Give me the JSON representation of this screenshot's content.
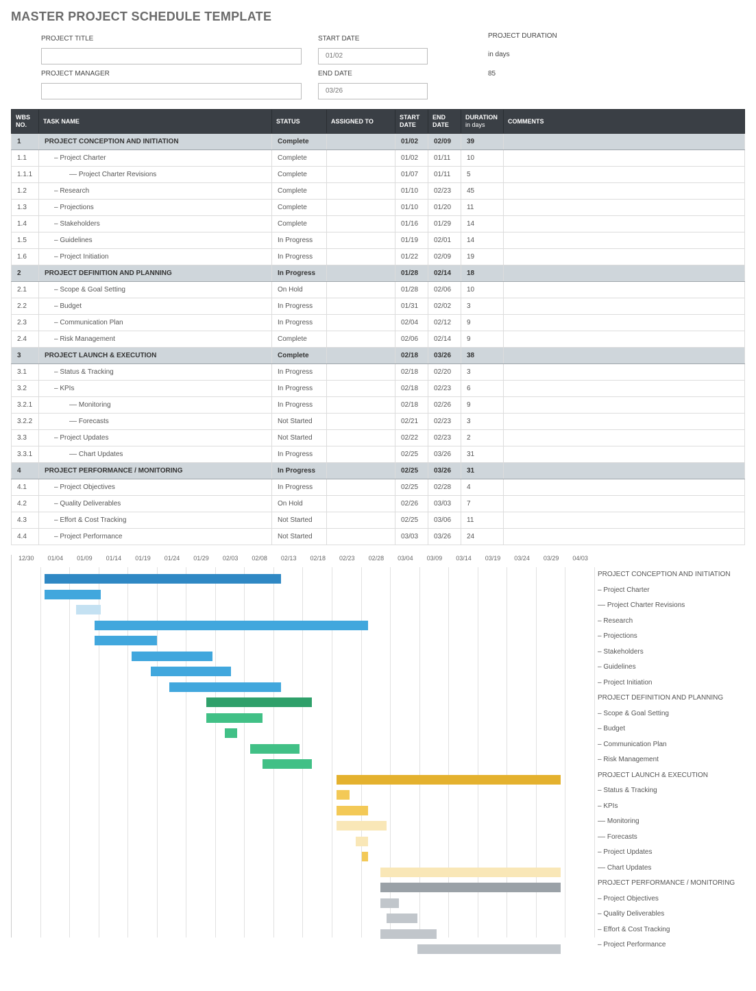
{
  "title": "MASTER PROJECT SCHEDULE TEMPLATE",
  "form": {
    "project_title_lbl": "PROJECT TITLE",
    "project_title_val": "",
    "project_manager_lbl": "PROJECT MANAGER",
    "project_manager_val": "",
    "start_date_lbl": "START DATE",
    "start_date_val": "01/02",
    "end_date_lbl": "END DATE",
    "end_date_val": "03/26",
    "duration_lbl": "PROJECT DURATION",
    "duration_unit": "in days",
    "duration_val": "85"
  },
  "headers": {
    "wbs": "WBS NO.",
    "task": "TASK NAME",
    "status": "STATUS",
    "assigned": "ASSIGNED TO",
    "start": "START DATE",
    "end": "END DATE",
    "dur": "DURATION",
    "dur_sub": "in days",
    "comments": "COMMENTS"
  },
  "rows": [
    {
      "wbs": "1",
      "name": "PROJECT CONCEPTION AND INITIATION",
      "status": "Complete",
      "assigned": "",
      "start": "01/02",
      "end": "02/09",
      "dur": "39",
      "comments": "",
      "section": true,
      "indent": 0
    },
    {
      "wbs": "1.1",
      "name": "– Project Charter",
      "status": "Complete",
      "assigned": "",
      "start": "01/02",
      "end": "01/11",
      "dur": "10",
      "comments": "",
      "section": false,
      "indent": 1
    },
    {
      "wbs": "1.1.1",
      "name": "–– Project Charter Revisions",
      "status": "Complete",
      "assigned": "",
      "start": "01/07",
      "end": "01/11",
      "dur": "5",
      "comments": "",
      "section": false,
      "indent": 2
    },
    {
      "wbs": "1.2",
      "name": "– Research",
      "status": "Complete",
      "assigned": "",
      "start": "01/10",
      "end": "02/23",
      "dur": "45",
      "comments": "",
      "section": false,
      "indent": 1
    },
    {
      "wbs": "1.3",
      "name": "– Projections",
      "status": "Complete",
      "assigned": "",
      "start": "01/10",
      "end": "01/20",
      "dur": "11",
      "comments": "",
      "section": false,
      "indent": 1
    },
    {
      "wbs": "1.4",
      "name": "– Stakeholders",
      "status": "Complete",
      "assigned": "",
      "start": "01/16",
      "end": "01/29",
      "dur": "14",
      "comments": "",
      "section": false,
      "indent": 1
    },
    {
      "wbs": "1.5",
      "name": "– Guidelines",
      "status": "In Progress",
      "assigned": "",
      "start": "01/19",
      "end": "02/01",
      "dur": "14",
      "comments": "",
      "section": false,
      "indent": 1
    },
    {
      "wbs": "1.6",
      "name": "– Project Initiation",
      "status": "In Progress",
      "assigned": "",
      "start": "01/22",
      "end": "02/09",
      "dur": "19",
      "comments": "",
      "section": false,
      "indent": 1
    },
    {
      "wbs": "2",
      "name": "PROJECT DEFINITION AND PLANNING",
      "status": "In Progress",
      "assigned": "",
      "start": "01/28",
      "end": "02/14",
      "dur": "18",
      "comments": "",
      "section": true,
      "indent": 0
    },
    {
      "wbs": "2.1",
      "name": "– Scope & Goal Setting",
      "status": "On Hold",
      "assigned": "",
      "start": "01/28",
      "end": "02/06",
      "dur": "10",
      "comments": "",
      "section": false,
      "indent": 1
    },
    {
      "wbs": "2.2",
      "name": "– Budget",
      "status": "In Progress",
      "assigned": "",
      "start": "01/31",
      "end": "02/02",
      "dur": "3",
      "comments": "",
      "section": false,
      "indent": 1
    },
    {
      "wbs": "2.3",
      "name": "– Communication Plan",
      "status": "In Progress",
      "assigned": "",
      "start": "02/04",
      "end": "02/12",
      "dur": "9",
      "comments": "",
      "section": false,
      "indent": 1
    },
    {
      "wbs": "2.4",
      "name": "– Risk Management",
      "status": "Complete",
      "assigned": "",
      "start": "02/06",
      "end": "02/14",
      "dur": "9",
      "comments": "",
      "section": false,
      "indent": 1
    },
    {
      "wbs": "3",
      "name": "PROJECT LAUNCH & EXECUTION",
      "status": "Complete",
      "assigned": "",
      "start": "02/18",
      "end": "03/26",
      "dur": "38",
      "comments": "",
      "section": true,
      "indent": 0
    },
    {
      "wbs": "3.1",
      "name": "– Status & Tracking",
      "status": "In Progress",
      "assigned": "",
      "start": "02/18",
      "end": "02/20",
      "dur": "3",
      "comments": "",
      "section": false,
      "indent": 1
    },
    {
      "wbs": "3.2",
      "name": "– KPIs",
      "status": "In Progress",
      "assigned": "",
      "start": "02/18",
      "end": "02/23",
      "dur": "6",
      "comments": "",
      "section": false,
      "indent": 1
    },
    {
      "wbs": "3.2.1",
      "name": "–– Monitoring",
      "status": "In Progress",
      "assigned": "",
      "start": "02/18",
      "end": "02/26",
      "dur": "9",
      "comments": "",
      "section": false,
      "indent": 2
    },
    {
      "wbs": "3.2.2",
      "name": "–– Forecasts",
      "status": "Not Started",
      "assigned": "",
      "start": "02/21",
      "end": "02/23",
      "dur": "3",
      "comments": "",
      "section": false,
      "indent": 2
    },
    {
      "wbs": "3.3",
      "name": "– Project Updates",
      "status": "Not Started",
      "assigned": "",
      "start": "02/22",
      "end": "02/23",
      "dur": "2",
      "comments": "",
      "section": false,
      "indent": 1
    },
    {
      "wbs": "3.3.1",
      "name": "–– Chart Updates",
      "status": "In Progress",
      "assigned": "",
      "start": "02/25",
      "end": "03/26",
      "dur": "31",
      "comments": "",
      "section": false,
      "indent": 2
    },
    {
      "wbs": "4",
      "name": "PROJECT PERFORMANCE / MONITORING",
      "status": "In Progress",
      "assigned": "",
      "start": "02/25",
      "end": "03/26",
      "dur": "31",
      "comments": "",
      "section": true,
      "indent": 0
    },
    {
      "wbs": "4.1",
      "name": "– Project Objectives",
      "status": "In Progress",
      "assigned": "",
      "start": "02/25",
      "end": "02/28",
      "dur": "4",
      "comments": "",
      "section": false,
      "indent": 1
    },
    {
      "wbs": "4.2",
      "name": "– Quality Deliverables",
      "status": "On Hold",
      "assigned": "",
      "start": "02/26",
      "end": "03/03",
      "dur": "7",
      "comments": "",
      "section": false,
      "indent": 1
    },
    {
      "wbs": "4.3",
      "name": "– Effort & Cost Tracking",
      "status": "Not Started",
      "assigned": "",
      "start": "02/25",
      "end": "03/06",
      "dur": "11",
      "comments": "",
      "section": false,
      "indent": 1
    },
    {
      "wbs": "4.4",
      "name": "– Project Performance",
      "status": "Not Started",
      "assigned": "",
      "start": "03/03",
      "end": "03/26",
      "dur": "24",
      "comments": "",
      "section": false,
      "indent": 1
    }
  ],
  "chart_data": {
    "type": "bar",
    "title": "",
    "xlabel": "",
    "ylabel": "",
    "axis_ticks": [
      "12/30",
      "01/04",
      "01/09",
      "01/14",
      "01/19",
      "01/24",
      "01/29",
      "02/03",
      "02/08",
      "02/13",
      "02/18",
      "02/23",
      "02/28",
      "03/04",
      "03/09",
      "03/14",
      "03/19",
      "03/24",
      "03/29",
      "04/03"
    ],
    "origin": "12/30",
    "series_colors": {
      "group1_dark": "#2f88c4",
      "group1_light": "#41a7dd",
      "group1_pale": "#c4e1f2",
      "group2_dark": "#2fa06a",
      "group2_light": "#41c086",
      "group3_dark": "#e4b12e",
      "group3_light": "#f3c957",
      "group3_pale": "#f9e7b7",
      "group4_dark": "#9aa1a7",
      "group4_light": "#c1c6cb"
    },
    "bars": [
      {
        "label": "PROJECT CONCEPTION AND INITIATION",
        "start": "01/02",
        "end": "02/09",
        "days": 39,
        "color": "group1_dark"
      },
      {
        "label": "– Project Charter",
        "start": "01/02",
        "end": "01/11",
        "days": 10,
        "color": "group1_light"
      },
      {
        "label": "–– Project Charter Revisions",
        "start": "01/07",
        "end": "01/11",
        "days": 5,
        "color": "group1_pale"
      },
      {
        "label": "– Research",
        "start": "01/10",
        "end": "02/23",
        "days": 45,
        "color": "group1_light"
      },
      {
        "label": "– Projections",
        "start": "01/10",
        "end": "01/20",
        "days": 11,
        "color": "group1_light"
      },
      {
        "label": "– Stakeholders",
        "start": "01/16",
        "end": "01/29",
        "days": 14,
        "color": "group1_light"
      },
      {
        "label": "– Guidelines",
        "start": "01/19",
        "end": "02/01",
        "days": 14,
        "color": "group1_light"
      },
      {
        "label": "– Project Initiation",
        "start": "01/22",
        "end": "02/09",
        "days": 19,
        "color": "group1_light"
      },
      {
        "label": "PROJECT DEFINITION AND PLANNING",
        "start": "01/28",
        "end": "02/14",
        "days": 18,
        "color": "group2_dark"
      },
      {
        "label": "– Scope & Goal Setting",
        "start": "01/28",
        "end": "02/06",
        "days": 10,
        "color": "group2_light"
      },
      {
        "label": "– Budget",
        "start": "01/31",
        "end": "02/02",
        "days": 3,
        "color": "group2_light"
      },
      {
        "label": "– Communication Plan",
        "start": "02/04",
        "end": "02/12",
        "days": 9,
        "color": "group2_light"
      },
      {
        "label": "– Risk Management",
        "start": "02/06",
        "end": "02/14",
        "days": 9,
        "color": "group2_light"
      },
      {
        "label": "PROJECT LAUNCH & EXECUTION",
        "start": "02/18",
        "end": "03/26",
        "days": 38,
        "color": "group3_dark"
      },
      {
        "label": "– Status & Tracking",
        "start": "02/18",
        "end": "02/20",
        "days": 3,
        "color": "group3_light"
      },
      {
        "label": "– KPIs",
        "start": "02/18",
        "end": "02/23",
        "days": 6,
        "color": "group3_light"
      },
      {
        "label": "–– Monitoring",
        "start": "02/18",
        "end": "02/26",
        "days": 9,
        "color": "group3_pale"
      },
      {
        "label": "–– Forecasts",
        "start": "02/21",
        "end": "02/23",
        "days": 3,
        "color": "group3_pale"
      },
      {
        "label": "– Project Updates",
        "start": "02/22",
        "end": "02/23",
        "days": 2,
        "color": "group3_light"
      },
      {
        "label": "–– Chart Updates",
        "start": "02/25",
        "end": "03/26",
        "days": 31,
        "color": "group3_pale"
      },
      {
        "label": "PROJECT PERFORMANCE / MONITORING",
        "start": "02/25",
        "end": "03/26",
        "days": 31,
        "color": "group4_dark"
      },
      {
        "label": "– Project Objectives",
        "start": "02/25",
        "end": "02/28",
        "days": 4,
        "color": "group4_light"
      },
      {
        "label": "– Quality Deliverables",
        "start": "02/26",
        "end": "03/03",
        "days": 7,
        "color": "group4_light"
      },
      {
        "label": "– Effort & Cost Tracking",
        "start": "02/25",
        "end": "03/06",
        "days": 11,
        "color": "group4_light"
      },
      {
        "label": "– Project Performance",
        "start": "03/03",
        "end": "03/26",
        "days": 24,
        "color": "group4_light"
      }
    ]
  }
}
